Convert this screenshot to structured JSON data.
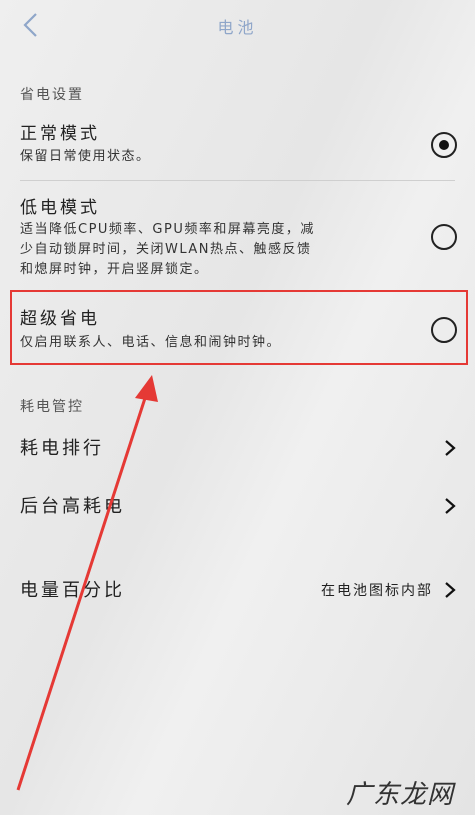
{
  "header": {
    "title": "电池",
    "back_icon": "chevron-left-icon"
  },
  "section_power_settings": {
    "label": "省电设置"
  },
  "modes": [
    {
      "title": "正常模式",
      "desc": "保留日常使用状态。",
      "selected": true
    },
    {
      "title": "低电模式",
      "desc_lines": [
        "适当降低CPU频率、GPU频率和屏幕亮度，减",
        "少自动锁屏时间，关闭WLAN热点、触感反馈",
        "和熄屏时钟，开启竖屏锁定。"
      ],
      "selected": false
    },
    {
      "title": "超级省电",
      "desc": "仅启用联系人、电话、信息和闹钟时钟。",
      "selected": false
    }
  ],
  "section_power_control": {
    "label": "耗电管控"
  },
  "rows": [
    {
      "title": "耗电排行"
    },
    {
      "title": "后台高耗电"
    }
  ],
  "battery_percent": {
    "title": "电量百分比",
    "value": "在电池图标内部"
  },
  "colors": {
    "highlight": "#e53935",
    "title": "#8fa6c9"
  },
  "watermark": {
    "text": "广东龙网"
  }
}
